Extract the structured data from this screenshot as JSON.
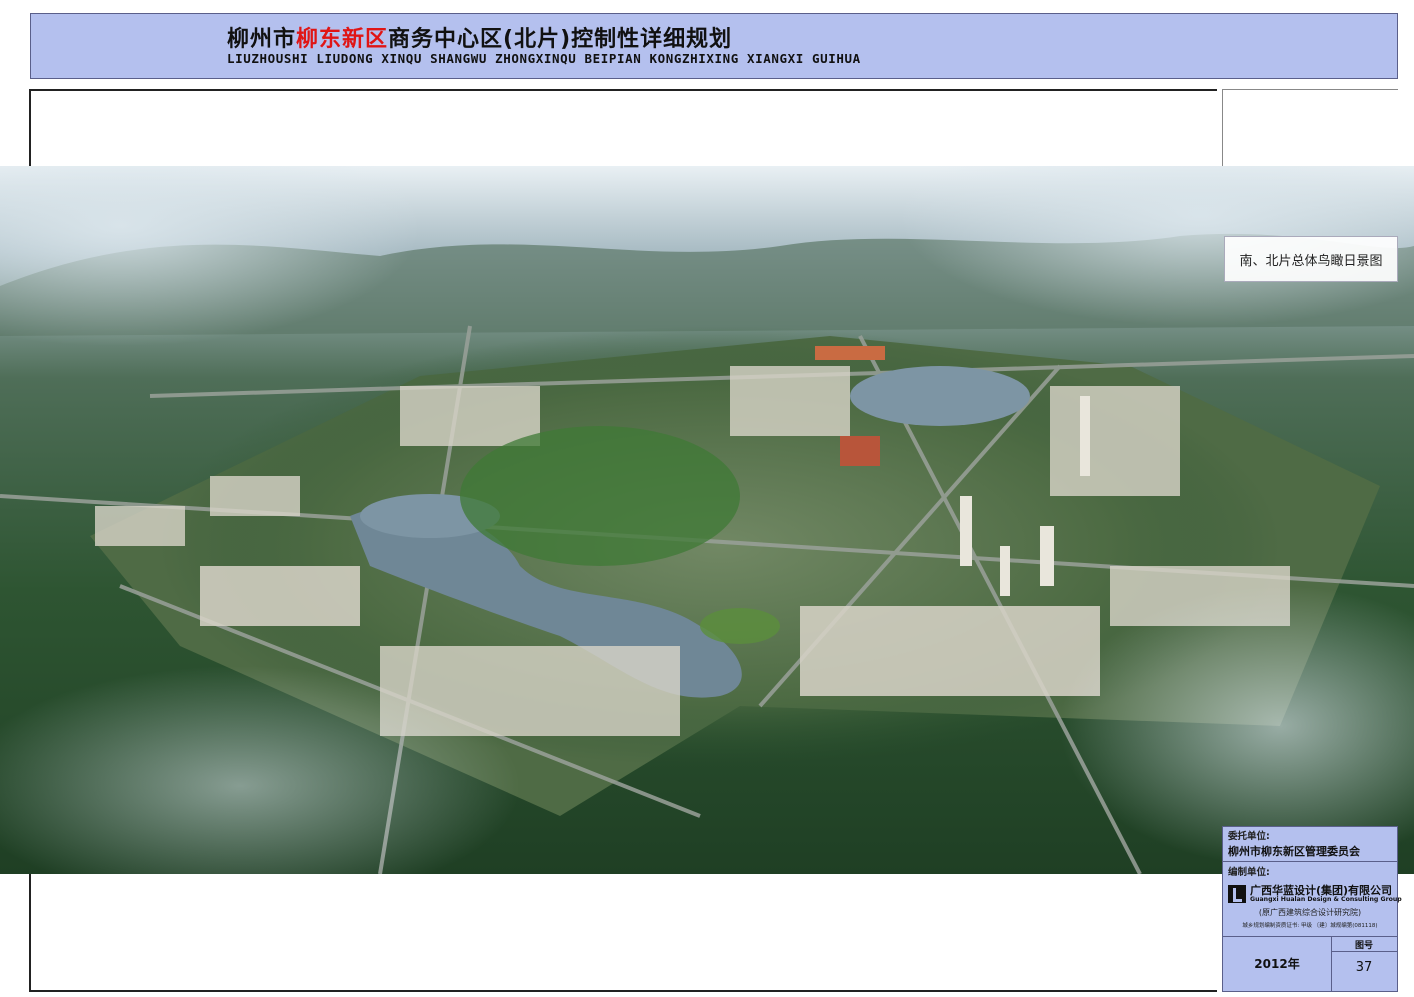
{
  "header": {
    "title_part1": "柳州市",
    "title_highlight": "柳东新区",
    "title_part2": "商务中心区(北片)控制性详细规划",
    "title_en": "LIUZHOUSHI LIUDONG XINQU SHANGWU ZHONGXINQU BEIPIAN KONGZHIXING XIANGXI GUIHUA",
    "highlight_color": "#e01515",
    "bg_color": "#b4c0ee"
  },
  "caption": "南、北片总体鸟瞰日景图",
  "image_icon": "aerial-rendering-image",
  "info": {
    "client_label": "委托单位:",
    "client_name": "柳州市柳东新区管理委员会",
    "maker_label": "编制单位:",
    "company_cn": "广西华蓝设计(集团)有限公司",
    "company_en": "Guangxi Hualan Design & Consulting Group",
    "company_old": "(原广西建筑综合设计研究院)",
    "certificate": "城乡规划编制资质证书: 甲级 〔建〕城规编第(081118)",
    "year": "2012年",
    "figure_label": "图号",
    "figure_number": "37"
  }
}
